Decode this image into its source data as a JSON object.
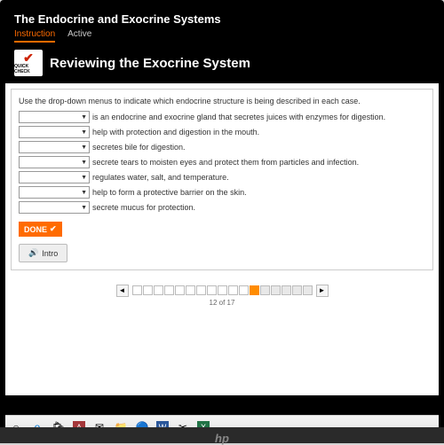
{
  "header": {
    "title": "The Endocrine and Exocrine Systems",
    "tabs": [
      "Instruction",
      "Active"
    ],
    "active_tab": 0
  },
  "quick_check": {
    "label": "QUICK CHECK"
  },
  "section": {
    "title": "Reviewing the Exocrine System"
  },
  "content": {
    "instruction": "Use the drop-down menus to indicate which endocrine structure is being described in each case.",
    "rows": [
      "is an endocrine and exocrine gland that secretes juices with enzymes for digestion.",
      "help with protection and digestion in the mouth.",
      "secretes bile for digestion.",
      "secrete tears to moisten eyes and protect them from particles and infection.",
      "regulates water, salt, and temperature.",
      "help to form a protective barrier on the skin.",
      "secrete mucus for protection."
    ],
    "done_label": "DONE",
    "intro_label": "Intro"
  },
  "pager": {
    "current": 12,
    "total": 17,
    "label": "12 of 17"
  },
  "hp": "hp"
}
